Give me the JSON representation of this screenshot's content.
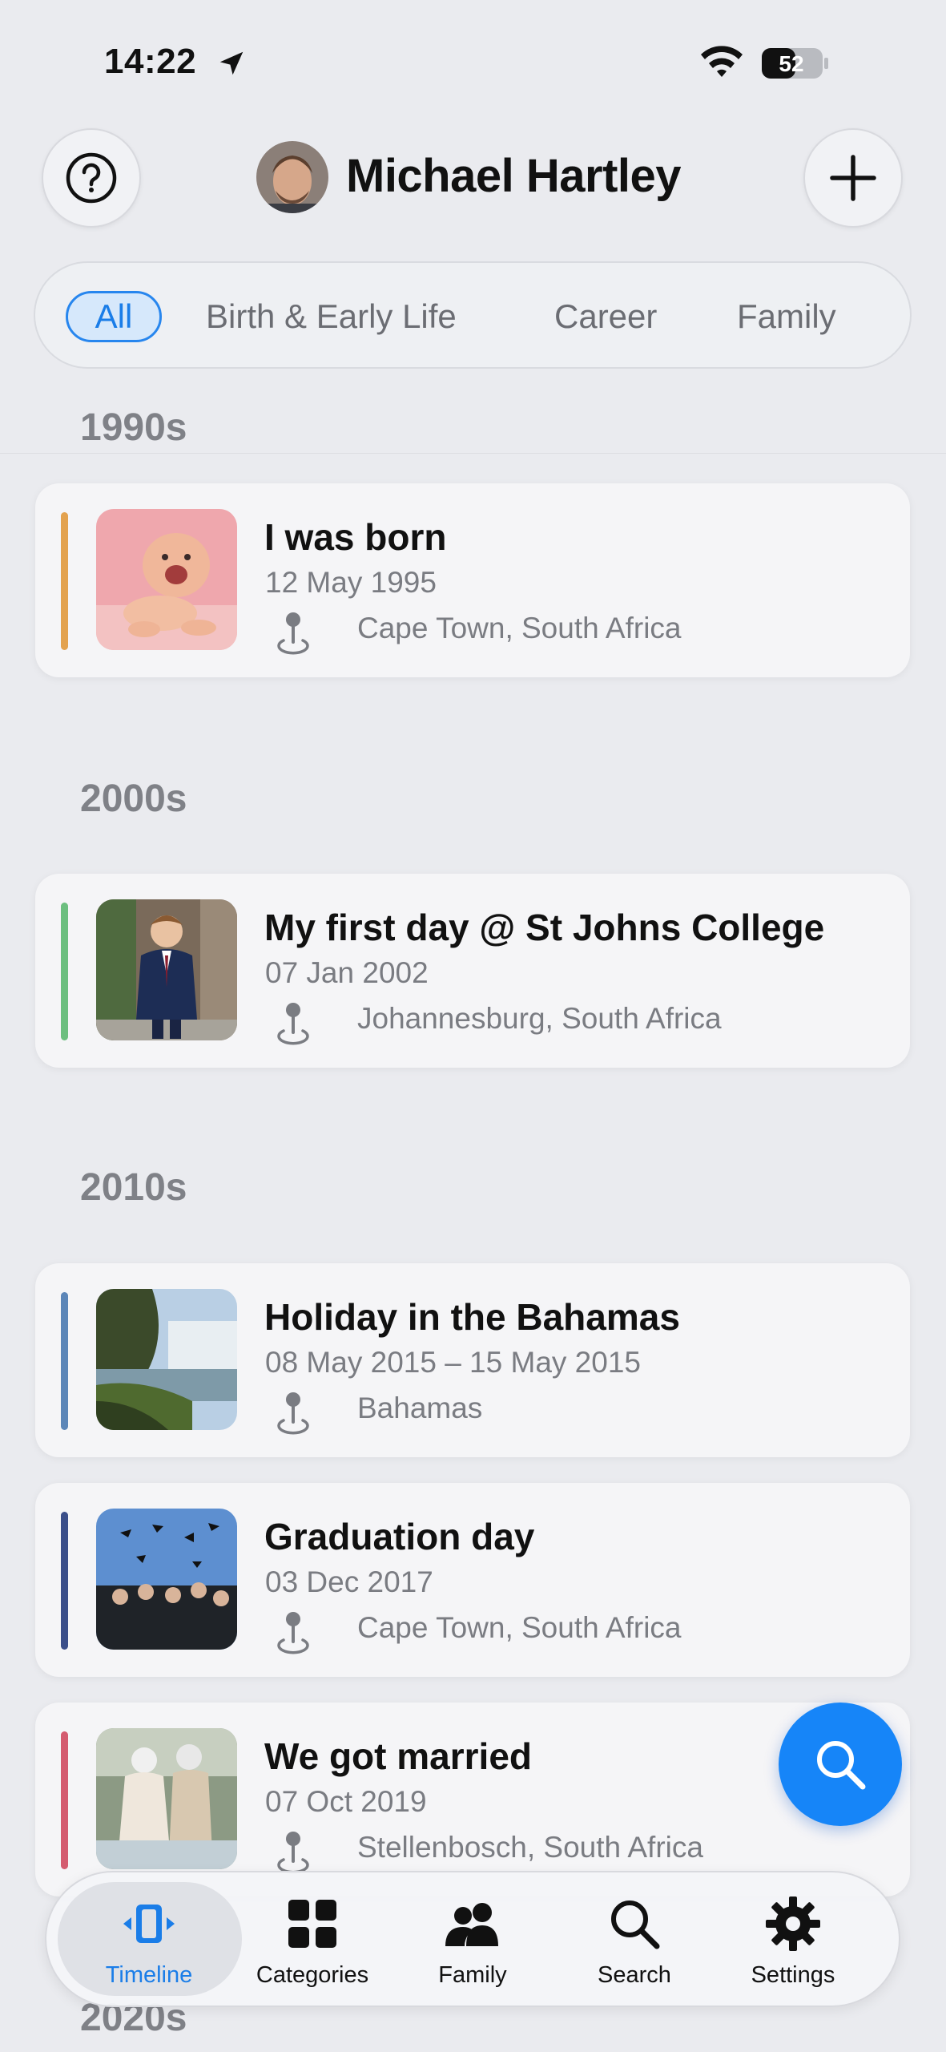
{
  "status_bar": {
    "time": "14:22",
    "battery": "52"
  },
  "header": {
    "name": "Michael Hartley"
  },
  "filters": [
    "All",
    "Birth & Early Life",
    "Career",
    "Family"
  ],
  "decades": [
    "1990s",
    "2000s",
    "2010s",
    "2020s"
  ],
  "events": [
    {
      "title": "I was born",
      "date": "12 May 1995",
      "place": "Cape Town, South Africa",
      "color": "#e3a24e"
    },
    {
      "title": "My first day @ St Johns College",
      "date": "07 Jan 2002",
      "place": "Johannesburg, South Africa",
      "color": "#6cbf7f"
    },
    {
      "title": "Holiday in the Bahamas",
      "date": "08 May 2015 – 15 May 2015",
      "place": "Bahamas",
      "color": "#5c86b8"
    },
    {
      "title": "Graduation day",
      "date": "03 Dec 2017",
      "place": "Cape Town, South Africa",
      "color": "#3b4f8a"
    },
    {
      "title": "We got married",
      "date": "07 Oct 2019",
      "place": "Stellenbosch, South Africa",
      "color": "#d45b6f"
    }
  ],
  "tabs": [
    "Timeline",
    "Categories",
    "Family",
    "Search",
    "Settings"
  ],
  "colors": {
    "accent": "#1685f8",
    "active_tab": "#1a7de8"
  }
}
